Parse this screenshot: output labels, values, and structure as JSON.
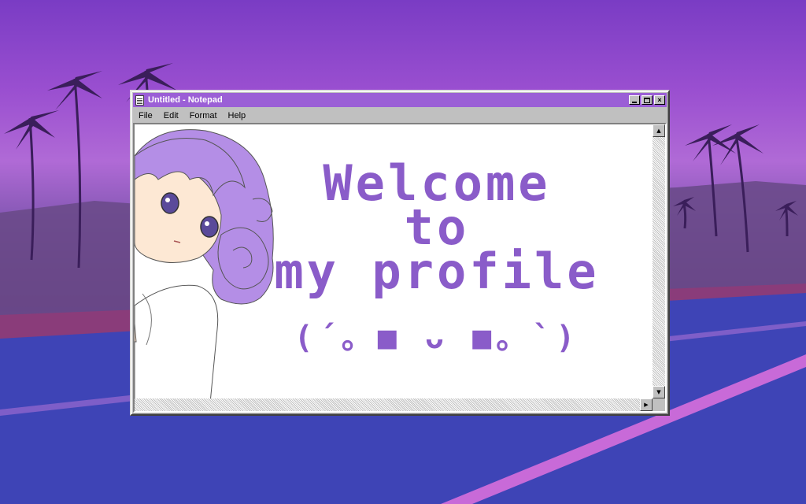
{
  "window": {
    "title": "Untitled - Notepad",
    "controls": {
      "minimize": "",
      "maximize": "",
      "close": "×"
    }
  },
  "menu": {
    "items": [
      "File",
      "Edit",
      "Format",
      "Help"
    ]
  },
  "document": {
    "lines": [
      "Welcome",
      "to",
      "my profile"
    ],
    "kaomoji": "(´。■ ᴗ ■。`)"
  },
  "colors": {
    "titlebar": "#9b5fd6",
    "text": "#8a5cc9",
    "sky": "#9a4fd0",
    "road": "#3e44b6"
  },
  "scrollbar": {
    "up": "▲",
    "down": "▼",
    "right": "▶"
  }
}
